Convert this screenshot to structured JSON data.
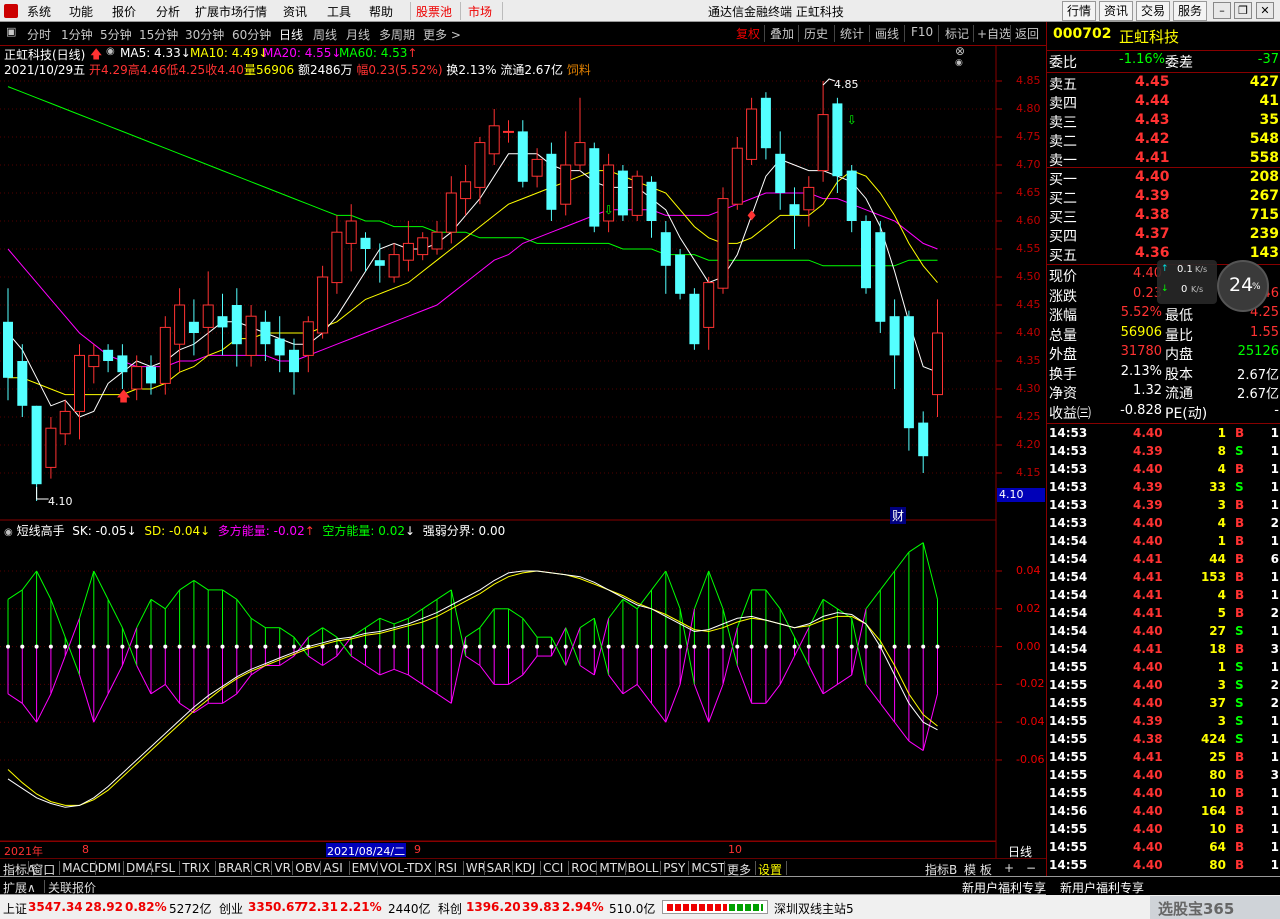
{
  "menu": {
    "items": [
      "系统",
      "功能",
      "报价",
      "分析",
      "扩展市场行情",
      "资讯",
      "工具",
      "帮助"
    ],
    "red_items": [
      "股票池",
      "市场"
    ],
    "title": "通达信金融终端 正虹科技",
    "right_buttons": [
      "行情",
      "资讯",
      "交易",
      "服务"
    ]
  },
  "toolbar": {
    "periods": [
      "分时",
      "1分钟",
      "5分钟",
      "15分钟",
      "30分钟",
      "60分钟",
      "日线",
      "周线",
      "月线",
      "多周期",
      "更多 >"
    ],
    "selected_period": "日线",
    "right": [
      "复权",
      "叠加",
      "历史",
      "统计",
      "画线",
      "F10",
      "标记",
      "+自选",
      "返回"
    ]
  },
  "main_chart": {
    "title": "正虹科技(日线)",
    "ma_labels": [
      {
        "text": "MA5: 4.33",
        "color": "#ffffff",
        "arrow": "↓"
      },
      {
        "text": "MA10: 4.49",
        "color": "#ffff00",
        "arrow": "↓"
      },
      {
        "text": "MA20: 4.55",
        "color": "#ff00ff",
        "arrow": "↓"
      },
      {
        "text": "MA60: 4.53",
        "color": "#00ff00",
        "arrow": "↑"
      }
    ],
    "bar_info": {
      "date": "2021/10/29五",
      "open": "开4.29",
      "high": "高4.46",
      "low": "低4.25",
      "close": "收4.40",
      "vol": "量56906",
      "amount": "额2486万",
      "amp": "幅0.23(5.52%)",
      "turnover": "换2.13%",
      "float": "流通2.67亿",
      "industry": "饲料"
    },
    "y_ticks": [
      "4.85",
      "4.80",
      "4.75",
      "4.70",
      "4.65",
      "4.60",
      "4.55",
      "4.50",
      "4.45",
      "4.40",
      "4.35",
      "4.30",
      "4.25",
      "4.20",
      "4.15"
    ],
    "high_label": "4.85",
    "low_label": "4.10",
    "cursor_price": "4.10",
    "cai_label": "财"
  },
  "indicator": {
    "title": "短线高手",
    "sk": "SK: -0.05",
    "sd": "SD: -0.04",
    "duo": "多方能量: -0.02",
    "kong": "空方能量: 0.02",
    "qr": "强弱分界: 0.00",
    "y_ticks": [
      "0.04",
      "0.02",
      "0.00",
      "-0.02",
      "-0.04",
      "-0.06"
    ]
  },
  "x_axis": {
    "year": "2021年",
    "months": [
      "8",
      "9",
      "10"
    ],
    "cursor_date": "2021/08/24/二",
    "period": "日线"
  },
  "bottom_tabs": [
    "指标A",
    "窗口",
    "MACD",
    "DMI",
    "DMA",
    "FSL",
    "TRIX",
    "BRAR",
    "CR",
    "VR",
    "OBV",
    "ASI",
    "EMV",
    "VOL-TDX",
    "RSI",
    "WR",
    "SAR",
    "KDJ",
    "CCI",
    "ROC",
    "MTM",
    "BOLL",
    "PSY",
    "MCST",
    "更多",
    "设置"
  ],
  "bottom_right": [
    "指标B",
    "模 板",
    "+",
    "−"
  ],
  "second_row": [
    "扩展∧",
    "关联报价"
  ],
  "stock": {
    "code": "000702",
    "name": "正虹科技",
    "weibi_label": "委比",
    "weibi": "-1.16%",
    "weicha_label": "委差",
    "weicha": "-37",
    "asks": [
      {
        "label": "卖五",
        "price": "4.45",
        "vol": "427"
      },
      {
        "label": "卖四",
        "price": "4.44",
        "vol": "41"
      },
      {
        "label": "卖三",
        "price": "4.43",
        "vol": "35"
      },
      {
        "label": "卖二",
        "price": "4.42",
        "vol": "548"
      },
      {
        "label": "卖一",
        "price": "4.41",
        "vol": "558"
      }
    ],
    "bids": [
      {
        "label": "买一",
        "price": "4.40",
        "vol": "208"
      },
      {
        "label": "买二",
        "price": "4.39",
        "vol": "267"
      },
      {
        "label": "买三",
        "price": "4.38",
        "vol": "715"
      },
      {
        "label": "买四",
        "price": "4.37",
        "vol": "239"
      },
      {
        "label": "买五",
        "price": "4.36",
        "vol": "143"
      }
    ],
    "stats": [
      {
        "l1": "现价",
        "v1": "4.40",
        "l2": "",
        "v2": "",
        "c1": "#ff3232",
        "c2": "#ff3232"
      },
      {
        "l1": "涨跌",
        "v1": "0.23",
        "l2": "",
        "v2": "4.46",
        "c1": "#ff3232",
        "c2": "#ff3232"
      },
      {
        "l1": "涨幅",
        "v1": "5.52%",
        "l2": "最低",
        "v2": "4.25",
        "c1": "#ff3232",
        "c2": "#ff3232"
      },
      {
        "l1": "总量",
        "v1": "56906",
        "l2": "量比",
        "v2": "1.55",
        "c1": "#ffff00",
        "c2": "#ff3232"
      },
      {
        "l1": "外盘",
        "v1": "31780",
        "l2": "内盘",
        "v2": "25126",
        "c1": "#ff3232",
        "c2": "#00ff00"
      },
      {
        "l1": "换手",
        "v1": "2.13%",
        "l2": "股本",
        "v2": "2.67亿",
        "c1": "#ffffff",
        "c2": "#ffffff"
      },
      {
        "l1": "净资",
        "v1": "1.32",
        "l2": "流通",
        "v2": "2.67亿",
        "c1": "#ffffff",
        "c2": "#ffffff"
      },
      {
        "l1": "收益㈢",
        "v1": "-0.828",
        "l2": "PE(动)",
        "v2": "-",
        "c1": "#ffffff",
        "c2": "#ffffff"
      }
    ],
    "speed": {
      "up": "0.1",
      "down": "0",
      "unit": "K/s",
      "pct": "24"
    },
    "ticks": [
      {
        "t": "14:53",
        "p": "4.40",
        "v": "1",
        "s": "B",
        "n": "1"
      },
      {
        "t": "14:53",
        "p": "4.39",
        "v": "8",
        "s": "S",
        "n": "1"
      },
      {
        "t": "14:53",
        "p": "4.40",
        "v": "4",
        "s": "B",
        "n": "1"
      },
      {
        "t": "14:53",
        "p": "4.39",
        "v": "33",
        "s": "S",
        "n": "1"
      },
      {
        "t": "14:53",
        "p": "4.39",
        "v": "3",
        "s": "B",
        "n": "1"
      },
      {
        "t": "14:53",
        "p": "4.40",
        "v": "4",
        "s": "B",
        "n": "2"
      },
      {
        "t": "14:54",
        "p": "4.40",
        "v": "1",
        "s": "B",
        "n": "1"
      },
      {
        "t": "14:54",
        "p": "4.41",
        "v": "44",
        "s": "B",
        "n": "6"
      },
      {
        "t": "14:54",
        "p": "4.41",
        "v": "153",
        "s": "B",
        "n": "1"
      },
      {
        "t": "14:54",
        "p": "4.41",
        "v": "4",
        "s": "B",
        "n": "1"
      },
      {
        "t": "14:54",
        "p": "4.41",
        "v": "5",
        "s": "B",
        "n": "2"
      },
      {
        "t": "14:54",
        "p": "4.40",
        "v": "27",
        "s": "S",
        "n": "1"
      },
      {
        "t": "14:54",
        "p": "4.41",
        "v": "18",
        "s": "B",
        "n": "3"
      },
      {
        "t": "14:55",
        "p": "4.40",
        "v": "1",
        "s": "S",
        "n": "1"
      },
      {
        "t": "14:55",
        "p": "4.40",
        "v": "3",
        "s": "S",
        "n": "2"
      },
      {
        "t": "14:55",
        "p": "4.40",
        "v": "37",
        "s": "S",
        "n": "2"
      },
      {
        "t": "14:55",
        "p": "4.39",
        "v": "3",
        "s": "S",
        "n": "1"
      },
      {
        "t": "14:55",
        "p": "4.38",
        "v": "424",
        "s": "S",
        "n": "1"
      },
      {
        "t": "14:55",
        "p": "4.41",
        "v": "25",
        "s": "B",
        "n": "1"
      },
      {
        "t": "14:55",
        "p": "4.40",
        "v": "80",
        "s": "B",
        "n": "3"
      },
      {
        "t": "14:55",
        "p": "4.40",
        "v": "10",
        "s": "B",
        "n": "1"
      },
      {
        "t": "14:56",
        "p": "4.40",
        "v": "164",
        "s": "B",
        "n": "1"
      },
      {
        "t": "14:55",
        "p": "4.40",
        "v": "10",
        "s": "B",
        "n": "1"
      },
      {
        "t": "14:55",
        "p": "4.40",
        "v": "64",
        "s": "B",
        "n": "1"
      },
      {
        "t": "14:55",
        "p": "4.40",
        "v": "80",
        "s": "B",
        "n": "1"
      }
    ],
    "promos": [
      "新用户福利专享",
      "新用户福利专享"
    ]
  },
  "status": {
    "sh": {
      "label": "上证",
      "v": "3547.34",
      "ch": "28.92",
      "pct": "0.82%",
      "amt": "5272亿"
    },
    "cy": {
      "label": "创业",
      "v": "3350.67",
      "ch": "72.31",
      "pct": "2.21%",
      "amt": "2440亿"
    },
    "kc": {
      "label": "科创",
      "v": "1396.20",
      "ch": "39.83",
      "pct": "2.94%",
      "amt": "510.0亿"
    },
    "server": "深圳双线主站5",
    "watermark": "选股宝365"
  },
  "chart_data": {
    "type": "candlestick",
    "ylim": [
      4.1,
      4.88
    ],
    "candles": [
      [
        4.42,
        4.32,
        4.48,
        4.28
      ],
      [
        4.35,
        4.27,
        4.38,
        4.25
      ],
      [
        4.27,
        4.13,
        4.27,
        4.1
      ],
      [
        4.16,
        4.23,
        4.25,
        4.14
      ],
      [
        4.22,
        4.26,
        4.28,
        4.2
      ],
      [
        4.26,
        4.36,
        4.38,
        4.21
      ],
      [
        4.34,
        4.36,
        4.38,
        4.31
      ],
      [
        4.37,
        4.35,
        4.38,
        4.33
      ],
      [
        4.36,
        4.33,
        4.38,
        4.3
      ],
      [
        4.3,
        4.34,
        4.36,
        4.28
      ],
      [
        4.34,
        4.31,
        4.36,
        4.29
      ],
      [
        4.31,
        4.41,
        4.43,
        4.29
      ],
      [
        4.38,
        4.45,
        4.48,
        4.33
      ],
      [
        4.42,
        4.4,
        4.46,
        4.36
      ],
      [
        4.41,
        4.45,
        4.51,
        4.36
      ],
      [
        4.43,
        4.41,
        4.47,
        4.36
      ],
      [
        4.45,
        4.38,
        4.48,
        4.34
      ],
      [
        4.36,
        4.43,
        4.45,
        4.34
      ],
      [
        4.42,
        4.38,
        4.44,
        4.35
      ],
      [
        4.39,
        4.36,
        4.43,
        4.33
      ],
      [
        4.37,
        4.33,
        4.39,
        4.29
      ],
      [
        4.36,
        4.42,
        4.43,
        4.33
      ],
      [
        4.4,
        4.5,
        4.52,
        4.39
      ],
      [
        4.49,
        4.58,
        4.61,
        4.47
      ],
      [
        4.56,
        4.6,
        4.63,
        4.51
      ],
      [
        4.57,
        4.55,
        4.58,
        4.51
      ],
      [
        4.53,
        4.52,
        4.56,
        4.49
      ],
      [
        4.5,
        4.54,
        4.56,
        4.49
      ],
      [
        4.53,
        4.56,
        4.6,
        4.51
      ],
      [
        4.54,
        4.57,
        4.58,
        4.53
      ],
      [
        4.55,
        4.58,
        4.6,
        4.54
      ],
      [
        4.58,
        4.65,
        4.68,
        4.56
      ],
      [
        4.64,
        4.67,
        4.7,
        4.61
      ],
      [
        4.66,
        4.74,
        4.75,
        4.63
      ],
      [
        4.72,
        4.77,
        4.8,
        4.7
      ],
      [
        4.76,
        4.76,
        4.78,
        4.74
      ],
      [
        4.76,
        4.67,
        4.78,
        4.66
      ],
      [
        4.68,
        4.71,
        4.73,
        4.66
      ],
      [
        4.72,
        4.62,
        4.74,
        4.6
      ],
      [
        4.63,
        4.7,
        4.76,
        4.61
      ],
      [
        4.7,
        4.74,
        4.82,
        4.69
      ],
      [
        4.73,
        4.59,
        4.74,
        4.58
      ],
      [
        4.6,
        4.7,
        4.72,
        4.58
      ],
      [
        4.69,
        4.61,
        4.7,
        4.6
      ],
      [
        4.61,
        4.68,
        4.69,
        4.6
      ],
      [
        4.67,
        4.6,
        4.68,
        4.57
      ],
      [
        4.58,
        4.52,
        4.6,
        4.47
      ],
      [
        4.54,
        4.47,
        4.55,
        4.46
      ],
      [
        4.47,
        4.38,
        4.48,
        4.37
      ],
      [
        4.41,
        4.49,
        4.5,
        4.37
      ],
      [
        4.48,
        4.64,
        4.66,
        4.47
      ],
      [
        4.63,
        4.73,
        4.75,
        4.62
      ],
      [
        4.71,
        4.8,
        4.82,
        4.7
      ],
      [
        4.82,
        4.73,
        4.83,
        4.71
      ],
      [
        4.72,
        4.65,
        4.76,
        4.62
      ],
      [
        4.63,
        4.61,
        4.66,
        4.55
      ],
      [
        4.62,
        4.66,
        4.68,
        4.59
      ],
      [
        4.69,
        4.79,
        4.85,
        4.67
      ],
      [
        4.81,
        4.68,
        4.82,
        4.65
      ],
      [
        4.69,
        4.6,
        4.7,
        4.58
      ],
      [
        4.6,
        4.48,
        4.61,
        4.47
      ],
      [
        4.58,
        4.42,
        4.6,
        4.4
      ],
      [
        4.43,
        4.36,
        4.46,
        4.3
      ],
      [
        4.43,
        4.23,
        4.44,
        4.19
      ],
      [
        4.24,
        4.18,
        4.26,
        4.15
      ],
      [
        4.29,
        4.4,
        4.46,
        4.25
      ]
    ],
    "ma5": [
      4.4,
      4.37,
      4.32,
      4.27,
      4.28,
      4.25,
      4.26,
      4.31,
      4.33,
      4.35,
      4.34,
      4.35,
      4.37,
      4.38,
      4.4,
      4.42,
      4.42,
      4.41,
      4.4,
      4.39,
      4.38,
      4.38,
      4.4,
      4.43,
      4.47,
      4.51,
      4.55,
      4.56,
      4.55,
      4.55,
      4.56,
      4.58,
      4.61,
      4.64,
      4.68,
      4.72,
      4.72,
      4.72,
      4.7,
      4.69,
      4.69,
      4.67,
      4.66,
      4.66,
      4.66,
      4.64,
      4.62,
      4.57,
      4.53,
      4.49,
      4.5,
      4.54,
      4.61,
      4.68,
      4.71,
      4.7,
      4.69,
      4.69,
      4.68,
      4.67,
      4.64,
      4.59,
      4.51,
      4.42,
      4.34,
      4.33
    ],
    "ma10": [
      4.32,
      4.32,
      4.31,
      4.3,
      4.29,
      4.29,
      4.29,
      4.29,
      4.29,
      4.3,
      4.3,
      4.31,
      4.33,
      4.34,
      4.36,
      4.37,
      4.39,
      4.39,
      4.4,
      4.4,
      4.4,
      4.4,
      4.41,
      4.42,
      4.44,
      4.46,
      4.47,
      4.48,
      4.49,
      4.51,
      4.53,
      4.55,
      4.57,
      4.59,
      4.61,
      4.63,
      4.64,
      4.65,
      4.66,
      4.67,
      4.68,
      4.69,
      4.69,
      4.68,
      4.67,
      4.66,
      4.65,
      4.62,
      4.59,
      4.57,
      4.56,
      4.56,
      4.57,
      4.59,
      4.61,
      4.61,
      4.61,
      4.63,
      4.67,
      4.69,
      4.68,
      4.65,
      4.61,
      4.56,
      4.52,
      4.49
    ],
    "ma20": [
      4.55,
      4.52,
      4.49,
      4.46,
      4.43,
      4.4,
      4.38,
      4.36,
      4.35,
      4.34,
      4.34,
      4.34,
      4.35,
      4.35,
      4.36,
      4.36,
      4.36,
      4.36,
      4.36,
      4.35,
      4.35,
      4.36,
      4.37,
      4.38,
      4.39,
      4.4,
      4.41,
      4.42,
      4.43,
      4.44,
      4.45,
      4.47,
      4.49,
      4.51,
      4.53,
      4.54,
      4.56,
      4.57,
      4.58,
      4.59,
      4.6,
      4.61,
      4.62,
      4.62,
      4.62,
      4.62,
      4.61,
      4.61,
      4.61,
      4.61,
      4.62,
      4.63,
      4.64,
      4.65,
      4.65,
      4.65,
      4.65,
      4.64,
      4.64,
      4.63,
      4.62,
      4.61,
      4.6,
      4.58,
      4.56,
      4.55
    ],
    "ma60": [
      4.84,
      4.83,
      4.82,
      4.81,
      4.8,
      4.79,
      4.78,
      4.77,
      4.76,
      4.75,
      4.74,
      4.73,
      4.72,
      4.71,
      4.7,
      4.69,
      4.68,
      4.67,
      4.66,
      4.65,
      4.64,
      4.63,
      4.62,
      4.61,
      4.61,
      4.6,
      4.6,
      4.59,
      4.59,
      4.59,
      4.58,
      4.58,
      4.58,
      4.57,
      4.57,
      4.57,
      4.57,
      4.56,
      4.56,
      4.56,
      4.56,
      4.56,
      4.56,
      4.55,
      4.55,
      4.55,
      4.54,
      4.54,
      4.54,
      4.53,
      4.53,
      4.53,
      4.53,
      4.53,
      4.53,
      4.53,
      4.53,
      4.52,
      4.52,
      4.52,
      4.52,
      4.52,
      4.52,
      4.53,
      4.53,
      4.53
    ],
    "osc_ylim": [
      -0.07,
      0.055
    ],
    "bars": [
      0.025,
      0.03,
      0.04,
      0.025,
      0.005,
      -0.015,
      -0.04,
      -0.025,
      -0.01,
      0.01,
      0.025,
      0.02,
      0.03,
      0.035,
      0.03,
      0.03,
      0.025,
      0.015,
      0.01,
      0.01,
      0.005,
      -0.005,
      -0.01,
      -0.005,
      0.005,
      0.01,
      0.015,
      0.012,
      0.015,
      0.02,
      0.025,
      0.03,
      -0.005,
      -0.01,
      -0.02,
      -0.02,
      -0.015,
      -0.005,
      -0.005,
      0.01,
      -0.01,
      -0.015,
      0.015,
      0.025,
      0.02,
      0.03,
      0.04,
      0.02,
      -0.02,
      -0.04,
      -0.02,
      0.01,
      0.03,
      0.03,
      0.02,
      0.005,
      -0.01,
      -0.025,
      -0.02,
      -0.015,
      0.02,
      0.03,
      0.04,
      0.05,
      0.055,
      0.025
    ],
    "sk": [
      -0.07,
      -0.075,
      -0.08,
      -0.083,
      -0.085,
      -0.084,
      -0.08,
      -0.074,
      -0.067,
      -0.06,
      -0.053,
      -0.046,
      -0.039,
      -0.032,
      -0.026,
      -0.021,
      -0.016,
      -0.012,
      -0.009,
      -0.006,
      -0.003,
      0.0,
      0.002,
      0.004,
      0.005,
      0.007,
      0.008,
      0.01,
      0.012,
      0.015,
      0.018,
      0.022,
      0.026,
      0.03,
      0.035,
      0.039,
      0.04,
      0.04,
      0.039,
      0.038,
      0.037,
      0.034,
      0.03,
      0.026,
      0.022,
      0.02,
      0.016,
      0.012,
      0.008,
      0.009,
      0.012,
      0.015,
      0.016,
      0.014,
      0.012,
      0.01,
      0.012,
      0.016,
      0.018,
      0.017,
      0.012,
      0.0,
      -0.015,
      -0.03,
      -0.04,
      -0.044
    ],
    "sd": [
      -0.065,
      -0.072,
      -0.078,
      -0.082,
      -0.084,
      -0.084,
      -0.081,
      -0.076,
      -0.069,
      -0.062,
      -0.055,
      -0.048,
      -0.041,
      -0.034,
      -0.028,
      -0.022,
      -0.017,
      -0.013,
      -0.01,
      -0.007,
      -0.004,
      -0.001,
      0.001,
      0.003,
      0.004,
      0.006,
      0.007,
      0.009,
      0.011,
      0.013,
      0.016,
      0.02,
      0.024,
      0.028,
      0.033,
      0.037,
      0.039,
      0.04,
      0.039,
      0.038,
      0.036,
      0.033,
      0.03,
      0.027,
      0.023,
      0.02,
      0.017,
      0.013,
      0.009,
      0.008,
      0.01,
      0.013,
      0.015,
      0.014,
      0.012,
      0.01,
      0.011,
      0.014,
      0.016,
      0.016,
      0.012,
      0.003,
      -0.01,
      -0.025,
      -0.036,
      -0.042
    ]
  }
}
